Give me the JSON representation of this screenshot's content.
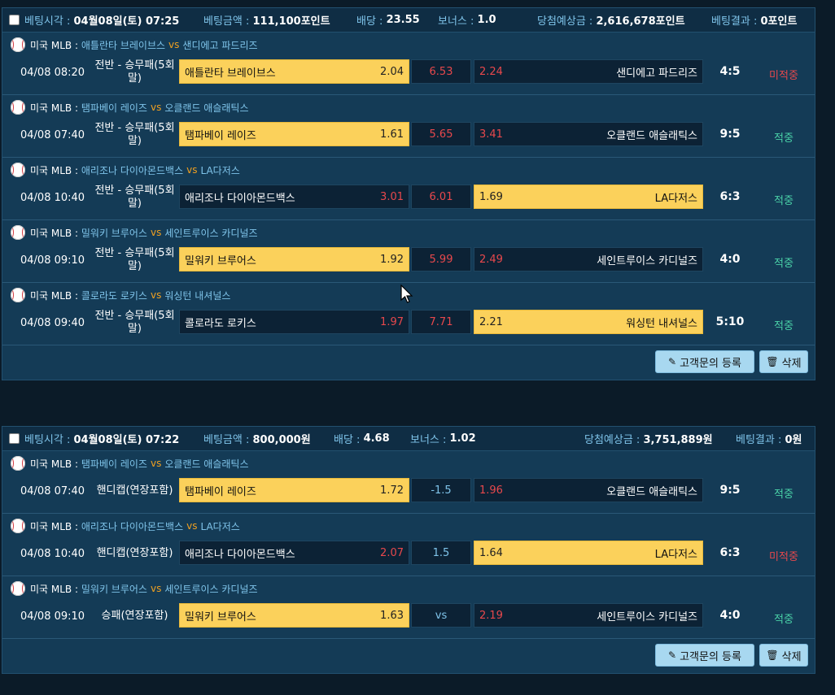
{
  "slips": [
    {
      "header": {
        "time_label": "베팅시각 :",
        "time_value": "04월08일(토) 07:25",
        "amount_label": "베팅금액 :",
        "amount_value": "111,100포인트",
        "odds_label": "배당 :",
        "odds_value": "23.55",
        "bonus_label": "보너스 :",
        "bonus_value": "1.0",
        "expected_label": "당첨예상금 :",
        "expected_value": "2,616,678포인트",
        "result_label": "베팅결과 :",
        "result_value": "0포인트"
      },
      "games": [
        {
          "league": "미국 MLB :",
          "home_team": "애틀란타 브레이브스",
          "vs": "vs",
          "away_team": "샌디에고 파드리즈",
          "datetime": "04/08 08:20",
          "market": "전반 - 승무패(5회말)",
          "home_name": "애틀란타 브레이브스",
          "home_odds": "2.04",
          "mid": "6.53",
          "away_odds": "2.24",
          "away_name": "샌디에고 파드리즈",
          "selected": "home",
          "score": "4:5",
          "result": "미적중",
          "hit": false
        },
        {
          "league": "미국 MLB :",
          "home_team": "탬파베이 레이즈",
          "vs": "vs",
          "away_team": "오클랜드 애슬래틱스",
          "datetime": "04/08 07:40",
          "market": "전반 - 승무패(5회말)",
          "home_name": "탬파베이 레이즈",
          "home_odds": "1.61",
          "mid": "5.65",
          "away_odds": "3.41",
          "away_name": "오클랜드 애슬래틱스",
          "selected": "home",
          "score": "9:5",
          "result": "적중",
          "hit": true
        },
        {
          "league": "미국 MLB :",
          "home_team": "애리조나 다이아몬드백스",
          "vs": "vs",
          "away_team": "LA다저스",
          "datetime": "04/08 10:40",
          "market": "전반 - 승무패(5회말)",
          "home_name": "애리조나 다이아몬드백스",
          "home_odds": "3.01",
          "mid": "6.01",
          "away_odds": "1.69",
          "away_name": "LA다저스",
          "selected": "away",
          "score": "6:3",
          "result": "적중",
          "hit": true
        },
        {
          "league": "미국 MLB :",
          "home_team": "밀워키 브루어스",
          "vs": "vs",
          "away_team": "세인트루이스 카디널즈",
          "datetime": "04/08 09:10",
          "market": "전반 - 승무패(5회말)",
          "home_name": "밀워키 브루어스",
          "home_odds": "1.92",
          "mid": "5.99",
          "away_odds": "2.49",
          "away_name": "세인트루이스 카디널즈",
          "selected": "home",
          "score": "4:0",
          "result": "적중",
          "hit": true
        },
        {
          "league": "미국 MLB :",
          "home_team": "콜로라도 로키스",
          "vs": "vs",
          "away_team": "워싱턴 내셔널스",
          "datetime": "04/08 09:40",
          "market": "전반 - 승무패(5회말)",
          "home_name": "콜로라도 로키스",
          "home_odds": "1.97",
          "mid": "7.71",
          "away_odds": "2.21",
          "away_name": "워싱턴 내셔널스",
          "selected": "away",
          "score": "5:10",
          "result": "적중",
          "hit": true
        }
      ],
      "buttons": {
        "inquiry": "고객문의 등록",
        "delete": "삭제"
      }
    },
    {
      "header": {
        "time_label": "베팅시각 :",
        "time_value": "04월08일(토) 07:22",
        "amount_label": "베팅금액 :",
        "amount_value": "800,000원",
        "odds_label": "배당 :",
        "odds_value": "4.68",
        "bonus_label": "보너스 :",
        "bonus_value": "1.02",
        "expected_label": "당첨예상금 :",
        "expected_value": "3,751,889원",
        "result_label": "베팅결과 :",
        "result_value": "0원"
      },
      "games": [
        {
          "league": "미국 MLB :",
          "home_team": "탬파베이 레이즈",
          "vs": "vs",
          "away_team": "오클랜드 애슬래틱스",
          "datetime": "04/08 07:40",
          "market": "핸디캡(연장포함)",
          "home_name": "탬파베이 레이즈",
          "home_odds": "1.72",
          "mid": "-1.5",
          "away_odds": "1.96",
          "away_name": "오클랜드 애슬래틱스",
          "selected": "home",
          "score": "9:5",
          "result": "적중",
          "hit": true
        },
        {
          "league": "미국 MLB :",
          "home_team": "애리조나 다이아몬드백스",
          "vs": "vs",
          "away_team": "LA다저스",
          "datetime": "04/08 10:40",
          "market": "핸디캡(연장포함)",
          "home_name": "애리조나 다이아몬드백스",
          "home_odds": "2.07",
          "mid": "1.5",
          "away_odds": "1.64",
          "away_name": "LA다저스",
          "selected": "away",
          "score": "6:3",
          "result": "미적중",
          "hit": false
        },
        {
          "league": "미국 MLB :",
          "home_team": "밀워키 브루어스",
          "vs": "vs",
          "away_team": "세인트루이스 카디널즈",
          "datetime": "04/08 09:10",
          "market": "승패(연장포함)",
          "home_name": "밀워키 브루어스",
          "home_odds": "1.63",
          "mid": "vs",
          "away_odds": "2.19",
          "away_name": "세인트루이스 카디널즈",
          "selected": "home",
          "score": "4:0",
          "result": "적중",
          "hit": true
        }
      ],
      "buttons": {
        "inquiry": "고객문의 등록",
        "delete": "삭제"
      }
    }
  ]
}
